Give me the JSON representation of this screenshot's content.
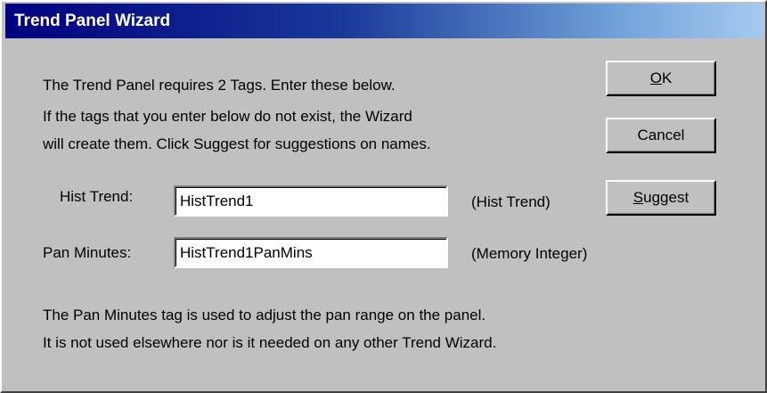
{
  "window": {
    "title": "Trend Panel Wizard"
  },
  "intro": {
    "line1": "The Trend Panel requires 2 Tags.  Enter these below.",
    "line2": "If the tags that you enter below do not exist, the Wizard",
    "line3": "will create them.  Click Suggest for suggestions on names."
  },
  "buttons": {
    "ok": {
      "accel": "O",
      "rest": "K"
    },
    "cancel": "Cancel",
    "suggest": {
      "accel": "S",
      "rest": "uggest"
    }
  },
  "fields": {
    "hist_trend": {
      "label": "Hist Trend:",
      "value": "HistTrend1",
      "type": "(Hist Trend)"
    },
    "pan_minutes": {
      "label": "Pan Minutes:",
      "value": "HistTrend1PanMins",
      "type": "(Memory Integer)"
    }
  },
  "footer": {
    "line1": "The Pan Minutes tag is used to adjust the pan range on the panel.",
    "line2": "It is not used elsewhere nor is it needed on any other Trend Wizard."
  }
}
